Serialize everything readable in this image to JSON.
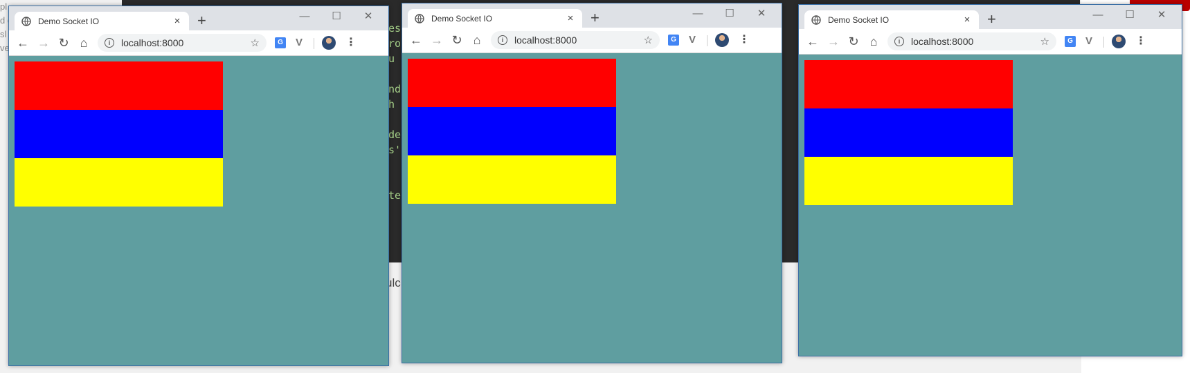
{
  "background": {
    "left_text": [
      "pl",
      "d c",
      "sl",
      "ve"
    ],
    "code_fragments": [
      "es",
      "ro",
      "u",
      "",
      "nd",
      " h",
      "",
      "de",
      "s'",
      "",
      "",
      "te"
    ],
    "light_text": "ulc"
  },
  "windows": [
    {
      "tab_title": "Demo Socket IO",
      "tab_close": "×",
      "new_tab": "+",
      "minimize": "—",
      "maximize": "☐",
      "close": "✕",
      "url": "localhost:8000",
      "stripes": [
        "#ff0000",
        "#0000ff",
        "#ffff00"
      ]
    },
    {
      "tab_title": "Demo Socket IO",
      "tab_close": "×",
      "new_tab": "+",
      "minimize": "—",
      "maximize": "☐",
      "close": "✕",
      "url": "localhost:8000",
      "stripes": [
        "#ff0000",
        "#0000ff",
        "#ffff00"
      ]
    },
    {
      "tab_title": "Demo Socket IO",
      "tab_close": "×",
      "new_tab": "+",
      "minimize": "—",
      "maximize": "☐",
      "close": "✕",
      "url": "localhost:8000",
      "stripes": [
        "#ff0000",
        "#0000ff",
        "#ffff00"
      ]
    }
  ],
  "colors": {
    "page_background": "#5f9ea0",
    "flag_top": "#ff0000",
    "flag_middle": "#0000ff",
    "flag_bottom": "#ffff00"
  },
  "icons": {
    "favicon": "globe-icon",
    "back": "back-arrow-icon",
    "forward": "forward-arrow-icon",
    "reload": "reload-icon",
    "home": "home-icon",
    "info": "info-icon",
    "bookmark": "star-icon",
    "translate": "translate-extension-icon",
    "vue": "vue-extension-icon",
    "profile": "avatar",
    "menu": "kebab-menu-icon"
  }
}
